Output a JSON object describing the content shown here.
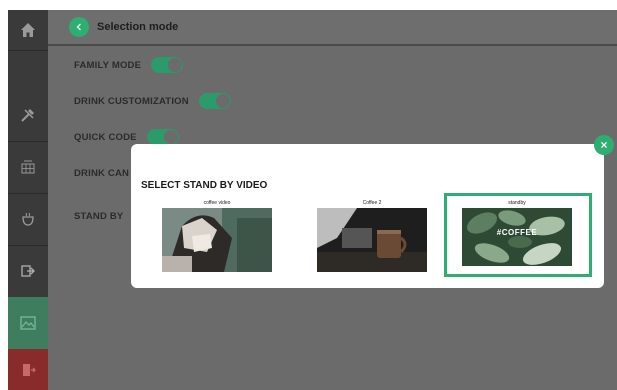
{
  "header": {
    "title": "Selection mode"
  },
  "settings": [
    {
      "label": "FAMILY MODE",
      "on": true
    },
    {
      "label": "DRINK CUSTOMIZATION",
      "on": true
    },
    {
      "label": "QUICK CODE",
      "on": true
    },
    {
      "label": "DRINK CAN",
      "on": null
    },
    {
      "label": "STAND BY",
      "on": null
    }
  ],
  "sidebar": {
    "items": [
      {
        "icon": "home-icon"
      },
      {
        "icon": "tools-icon"
      },
      {
        "icon": "grid-icon"
      },
      {
        "icon": "cup-icon"
      },
      {
        "icon": "export-icon"
      },
      {
        "icon": "image-icon"
      },
      {
        "icon": "logout-icon"
      }
    ]
  },
  "modal": {
    "title": "SELECT STAND BY VIDEO",
    "videos": [
      {
        "name": "coffee video",
        "selected": false
      },
      {
        "name": "Coffee 2",
        "selected": false
      },
      {
        "name": "standby",
        "selected": true,
        "overlay_text": "#COFFEE"
      }
    ],
    "close_label": "×"
  },
  "colors": {
    "accent": "#2fae72",
    "overlay": "#6b6b6b",
    "sidebar": "#3a3a3a"
  }
}
